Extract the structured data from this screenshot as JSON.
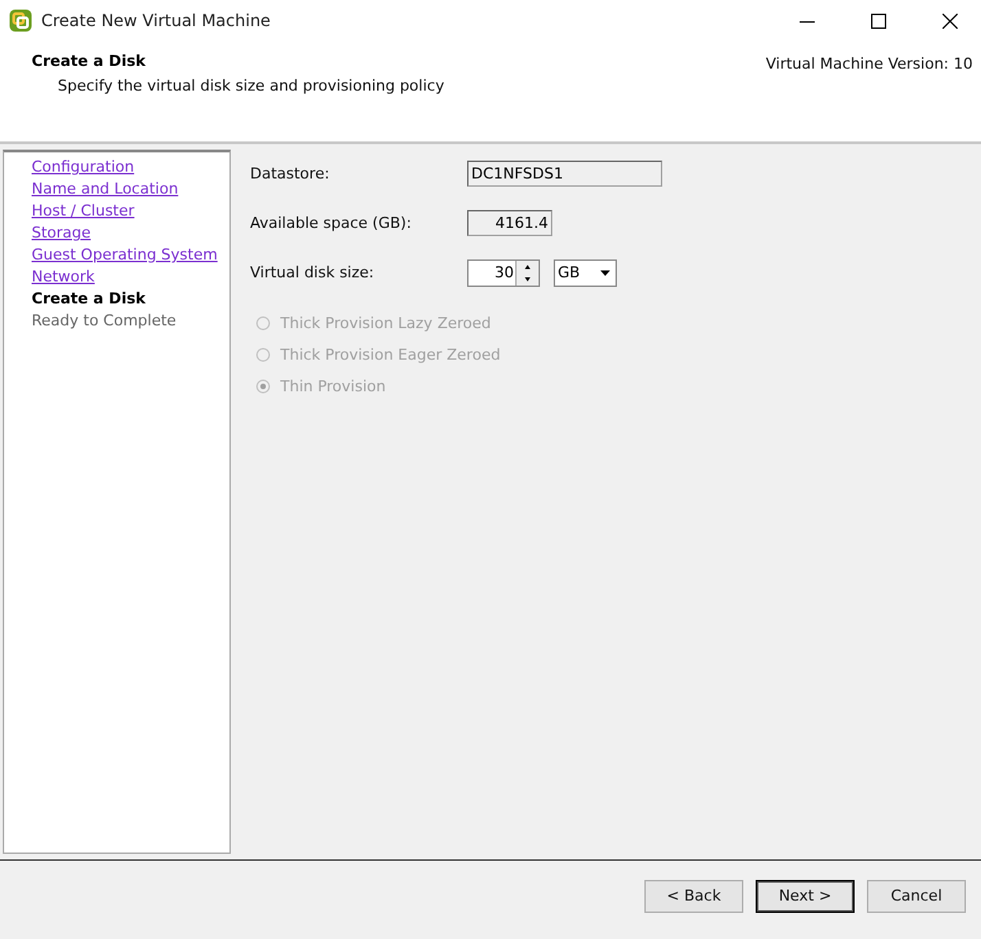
{
  "window": {
    "title": "Create New Virtual Machine"
  },
  "header": {
    "title": "Create a Disk",
    "subtitle": "Specify the virtual disk size and provisioning policy",
    "version": "Virtual Machine Version: 10"
  },
  "steps": [
    {
      "label": "Configuration",
      "kind": "link"
    },
    {
      "label": "Name and Location",
      "kind": "link"
    },
    {
      "label": "Host / Cluster",
      "kind": "link"
    },
    {
      "label": "Storage",
      "kind": "link"
    },
    {
      "label": "Guest Operating System",
      "kind": "link"
    },
    {
      "label": "Network",
      "kind": "link"
    },
    {
      "label": "Create a Disk",
      "kind": "current"
    },
    {
      "label": "Ready to Complete",
      "kind": "pending"
    }
  ],
  "form": {
    "datastore_label": "Datastore:",
    "datastore": "DC1NFSDS1",
    "available_label": "Available space (GB):",
    "available": "4161.4",
    "size_label": "Virtual disk size:",
    "size": "30",
    "unit": "GB"
  },
  "provisioning": [
    {
      "label": "Thick Provision Lazy Zeroed",
      "selected": false,
      "disabled": true
    },
    {
      "label": "Thick Provision Eager Zeroed",
      "selected": false,
      "disabled": true
    },
    {
      "label": "Thin Provision",
      "selected": true,
      "disabled": true
    }
  ],
  "buttons": [
    {
      "label": "< Back",
      "default": false
    },
    {
      "label": "Next >",
      "default": true
    },
    {
      "label": "Cancel",
      "default": false
    }
  ]
}
